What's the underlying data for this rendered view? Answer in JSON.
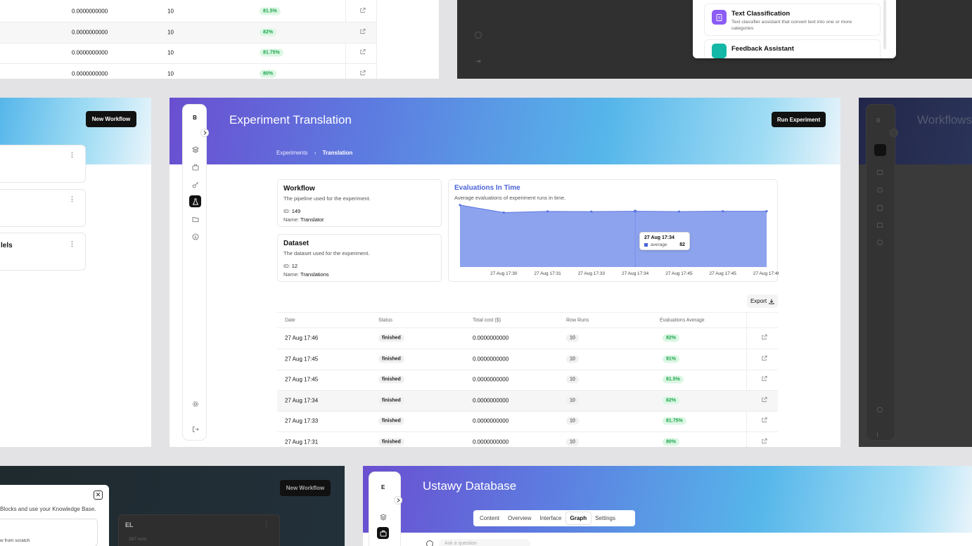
{
  "top_left": {
    "rows": [
      {
        "cost": "0.0000000000",
        "runs": "10",
        "eval": "81.5%"
      },
      {
        "cost": "0.0000000000",
        "runs": "10",
        "eval": "82%"
      },
      {
        "cost": "0.0000000000",
        "runs": "10",
        "eval": "81.75%"
      },
      {
        "cost": "0.0000000000",
        "runs": "10",
        "eval": "80%"
      }
    ]
  },
  "top_right": {
    "items": [
      {
        "title": "Text Classification",
        "desc": "Text classifier assistant that convert text into one or more categories",
        "color": "#8b5cf6"
      },
      {
        "title": "Feedback Assistant",
        "desc": "",
        "color": "#14b8a6"
      }
    ]
  },
  "middle_left": {
    "new_workflow_label": "New Workflow",
    "cards": [
      {
        "title": ""
      },
      {
        "title": ""
      },
      {
        "title": "lels"
      }
    ]
  },
  "center": {
    "sidebar": {
      "avatar": "B"
    },
    "title": "Experiment Translation",
    "run_button": "Run Experiment",
    "breadcrumb": {
      "root": "Experiments",
      "current": "Translation"
    },
    "workflow": {
      "title": "Workflow",
      "desc": "The pipeline used for the experiment.",
      "id_label": "ID:",
      "id": "149",
      "name_label": "Name:",
      "name": "Translator"
    },
    "dataset": {
      "title": "Dataset",
      "desc": "The dataset used for the experiment.",
      "id_label": "ID:",
      "id": "12",
      "name_label": "Name:",
      "name": "Translations"
    },
    "chart": {
      "title": "Evaluations In Time",
      "subtitle": "Average evaluations of experiment runs in time.",
      "tooltip": {
        "date": "27 Aug 17:34",
        "series": "average",
        "value": "82"
      }
    },
    "export_label": "Export",
    "table": {
      "headers": [
        "Date",
        "Status",
        "Total cost ($)",
        "Row Runs",
        "Evaluations Average"
      ],
      "rows": [
        {
          "date": "27 Aug 17:46",
          "status": "finished",
          "cost": "0.0000000000",
          "runs": "10",
          "eval": "82%"
        },
        {
          "date": "27 Aug 17:45",
          "status": "finished",
          "cost": "0.0000000000",
          "runs": "10",
          "eval": "91%"
        },
        {
          "date": "27 Aug 17:45",
          "status": "finished",
          "cost": "0.0000000000",
          "runs": "10",
          "eval": "81.5%"
        },
        {
          "date": "27 Aug 17:34",
          "status": "finished",
          "cost": "0.0000000000",
          "runs": "10",
          "eval": "82%"
        },
        {
          "date": "27 Aug 17:33",
          "status": "finished",
          "cost": "0.0000000000",
          "runs": "10",
          "eval": "81.75%"
        },
        {
          "date": "27 Aug 17:31",
          "status": "finished",
          "cost": "0.0000000000",
          "runs": "10",
          "eval": "80%"
        }
      ]
    }
  },
  "chart_data": {
    "type": "area",
    "title": "Evaluations In Time",
    "subtitle": "Average evaluations of experiment runs in time.",
    "x": [
      "27 Aug 17:30",
      "27 Aug 17:31",
      "27 Aug 17:33",
      "27 Aug 17:34",
      "27 Aug 17:45",
      "27 Aug 17:45",
      "27 Aug 17:46"
    ],
    "series": [
      {
        "name": "average",
        "values": [
          91,
          80,
          81.75,
          81.5,
          82,
          81.5,
          82,
          82
        ]
      }
    ],
    "x_full": [
      "",
      "27 Aug 17:30",
      "27 Aug 17:31",
      "27 Aug 17:33",
      "27 Aug 17:34",
      "27 Aug 17:45",
      "27 Aug 17:45",
      "27 Aug 17:46"
    ],
    "ylim": [
      0,
      95
    ],
    "grid": false,
    "color": "#5b74e0"
  },
  "middle_right": {
    "title": "Workflows",
    "avatar": "B"
  },
  "bottom_left": {
    "modal_text": "Blocks and use your Knowledge Base.",
    "modal_sub": "w from scratch",
    "new_workflow_label": "New Workflow",
    "card_title": "EL",
    "card_meta": "267 runs"
  },
  "bottom_right": {
    "avatar": "E",
    "title": "Ustawy Database",
    "tabs": [
      "Content",
      "Overview",
      "Interface",
      "Graph",
      "Settings"
    ],
    "active_tab": "Graph",
    "search_placeholder": "Ask a question"
  }
}
